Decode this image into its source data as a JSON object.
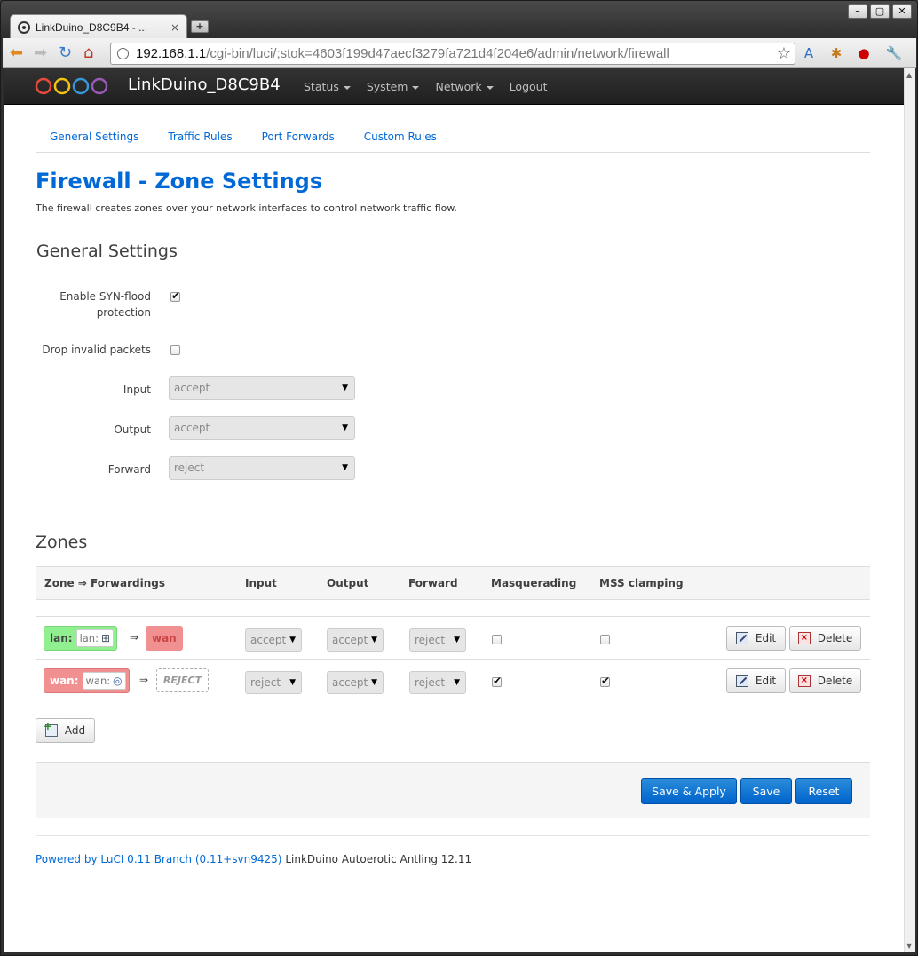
{
  "browser": {
    "tab_title": "LinkDuino_D8C9B4 - ...",
    "tab_close": "×",
    "new_tab": "+",
    "window_buttons": [
      "–",
      "▢",
      "✕"
    ],
    "url_host": "192.168.1.1",
    "url_path": "/cgi-bin/luci/;stok=4603f199d47aecf3279fa721d4f204e6/admin/network/firewall"
  },
  "navbar": {
    "brand": "LinkDuino_D8C9B4",
    "menu": [
      {
        "label": "Status"
      },
      {
        "label": "System"
      },
      {
        "label": "Network"
      },
      {
        "label": "Logout"
      }
    ]
  },
  "subtabs": [
    "General Settings",
    "Traffic Rules",
    "Port Forwards",
    "Custom Rules"
  ],
  "page": {
    "title": "Firewall - Zone Settings",
    "description": "The firewall creates zones over your network interfaces to control network traffic flow."
  },
  "general": {
    "heading": "General Settings",
    "syn_label_1": "Enable SYN-flood",
    "syn_label_2": "protection",
    "syn_checked": true,
    "drop_label": "Drop invalid packets",
    "drop_checked": false,
    "input_label": "Input",
    "input_value": "accept",
    "output_label": "Output",
    "output_value": "accept",
    "forward_label": "Forward",
    "forward_value": "reject"
  },
  "zones": {
    "heading": "Zones",
    "columns": [
      "Zone ⇒ Forwardings",
      "Input",
      "Output",
      "Forward",
      "Masquerading",
      "MSS clamping"
    ],
    "rows": [
      {
        "zone": "lan:",
        "iface": "lan:",
        "forward_to": "wan",
        "input": "accept",
        "output": "accept",
        "forward": "reject",
        "masquerading": false,
        "mss_clamping": false
      },
      {
        "zone": "wan:",
        "iface": "wan:",
        "forward_to": "REJECT",
        "input": "reject",
        "output": "accept",
        "forward": "reject",
        "masquerading": true,
        "mss_clamping": true
      }
    ],
    "arrow": "⇒",
    "edit_label": "Edit",
    "delete_label": "Delete",
    "add_label": "Add"
  },
  "actions": {
    "save_apply": "Save & Apply",
    "save": "Save",
    "reset": "Reset"
  },
  "footer": {
    "link": "Powered by LuCI 0.11 Branch (0.11+svn9425)",
    "text": " LinkDuino Autoerotic Antling 12.11"
  },
  "colors": {
    "accent": "#0069d6",
    "lan_zone": "#90f090",
    "wan_zone": "#f09090",
    "primary_button": "#0064cd"
  }
}
